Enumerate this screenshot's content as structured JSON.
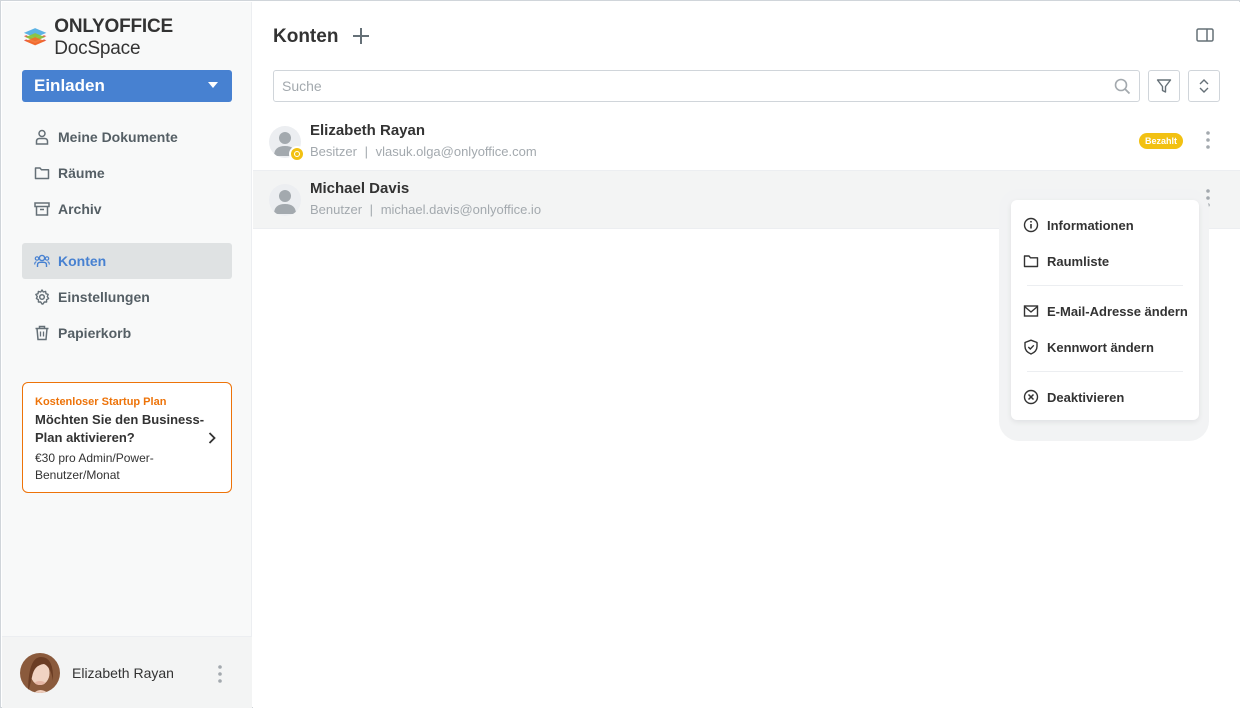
{
  "app": {
    "logo_brand": "ONLYOFFICE",
    "logo_product": " DocSpace"
  },
  "sidebar": {
    "invite_label": "Einladen",
    "items": [
      {
        "label": "Meine Dokumente",
        "icon": "user-icon"
      },
      {
        "label": "Räume",
        "icon": "folder-icon"
      },
      {
        "label": "Archiv",
        "icon": "archive-icon"
      },
      {
        "label": "Konten",
        "icon": "accounts-icon",
        "active": true
      },
      {
        "label": "Einstellungen",
        "icon": "gear-icon"
      },
      {
        "label": "Papierkorb",
        "icon": "trash-icon"
      }
    ],
    "promo": {
      "tag": "Kostenloser Startup Plan",
      "title": "Möchten Sie den Business-Plan aktivieren?",
      "text": "€30 pro Admin/Power-Benutzer/Monat"
    },
    "profile_name": "Elizabeth Rayan"
  },
  "main": {
    "title": "Konten",
    "search_placeholder": "Suche",
    "users": [
      {
        "name": "Elizabeth Rayan",
        "role": "Besitzer",
        "email": "vlasuk.olga@onlyoffice.com",
        "badge": "Bezahlt",
        "owner": true
      },
      {
        "name": "Michael Davis",
        "role": "Benutzer",
        "email": "michael.davis@onlyoffice.io",
        "badge": "",
        "owner": false
      }
    ],
    "separator": "|"
  },
  "context_menu": {
    "items": [
      {
        "label": "Informationen",
        "icon": "info-icon"
      },
      {
        "label": "Raumliste",
        "icon": "folder-icon"
      },
      {
        "label": "E-Mail-Adresse ändern",
        "icon": "mail-icon"
      },
      {
        "label": "Kennwort ändern",
        "icon": "shield-icon"
      },
      {
        "label": "Deaktivieren",
        "icon": "deactivate-icon"
      }
    ]
  },
  "colors": {
    "accent": "#4781d1",
    "promo_orange": "#ed7309",
    "paid_yellow": "#f2c112"
  }
}
